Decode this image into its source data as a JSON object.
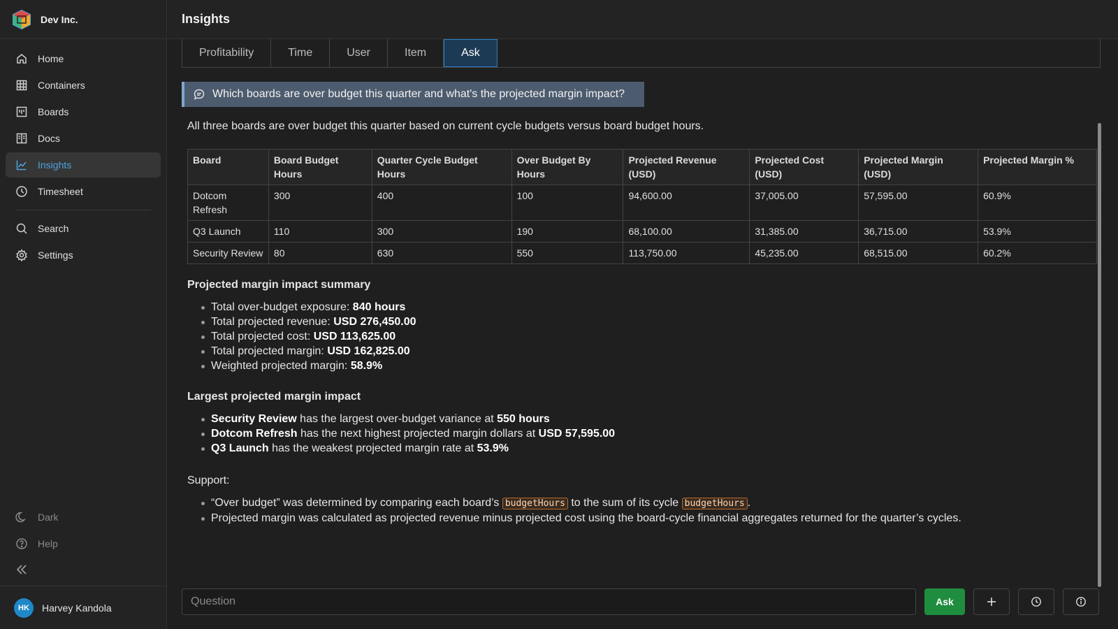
{
  "brand": {
    "name": "Dev Inc."
  },
  "nav": {
    "items": [
      {
        "label": "Home",
        "icon": "home-icon"
      },
      {
        "label": "Containers",
        "icon": "grid-icon"
      },
      {
        "label": "Boards",
        "icon": "board-icon"
      },
      {
        "label": "Docs",
        "icon": "book-icon"
      },
      {
        "label": "Insights",
        "icon": "chart-icon",
        "active": true
      },
      {
        "label": "Timesheet",
        "icon": "clock-icon"
      }
    ],
    "secondary": [
      {
        "label": "Search",
        "icon": "search-icon"
      },
      {
        "label": "Settings",
        "icon": "gear-icon"
      }
    ],
    "bottom": [
      {
        "label": "Dark",
        "icon": "moon-icon"
      },
      {
        "label": "Help",
        "icon": "help-icon"
      }
    ]
  },
  "user": {
    "initials": "HK",
    "name": "Harvey Kandola"
  },
  "header": {
    "title": "Insights"
  },
  "tabs": [
    {
      "label": "Profitability"
    },
    {
      "label": "Time"
    },
    {
      "label": "User"
    },
    {
      "label": "Item"
    },
    {
      "label": "Ask",
      "active": true
    }
  ],
  "question": "Which boards are over budget this quarter and what's the projected margin impact?",
  "answer": {
    "intro": "All three boards are over budget this quarter based on current cycle budgets versus board budget hours.",
    "table": {
      "headers": [
        "Board",
        "Board Budget Hours",
        "Quarter Cycle Budget Hours",
        "Over Budget By Hours",
        "Projected Revenue (USD)",
        "Projected Cost (USD)",
        "Projected Margin (USD)",
        "Projected Margin %"
      ],
      "rows": [
        [
          "Dotcom Refresh",
          "300",
          "400",
          "100",
          "94,600.00",
          "37,005.00",
          "57,595.00",
          "60.9%"
        ],
        [
          "Q3 Launch",
          "110",
          "300",
          "190",
          "68,100.00",
          "31,385.00",
          "36,715.00",
          "53.9%"
        ],
        [
          "Security Review",
          "80",
          "630",
          "550",
          "113,750.00",
          "45,235.00",
          "68,515.00",
          "60.2%"
        ]
      ]
    },
    "summary": {
      "title": "Projected margin impact summary",
      "items": [
        {
          "label": "Total over-budget exposure: ",
          "value": "840 hours"
        },
        {
          "label": "Total projected revenue: ",
          "value": "USD 276,450.00"
        },
        {
          "label": "Total projected cost: ",
          "value": "USD 113,625.00"
        },
        {
          "label": "Total projected margin: ",
          "value": "USD 162,825.00"
        },
        {
          "label": "Weighted projected margin: ",
          "value": "58.9%"
        }
      ]
    },
    "largest": {
      "title": "Largest projected margin impact",
      "items": [
        {
          "board": "Security Review",
          "text": " has the largest over-budget variance at ",
          "value": "550 hours"
        },
        {
          "board": "Dotcom Refresh",
          "text": " has the next highest projected margin dollars at ",
          "value": "USD 57,595.00"
        },
        {
          "board": "Q3 Launch",
          "text": " has the weakest projected margin rate at ",
          "value": "53.9%"
        }
      ]
    },
    "support": {
      "title": "Support:",
      "item1": {
        "pre": "“Over budget” was determined by comparing each board’s ",
        "code1": "budgetHours",
        "mid": " to the sum of its cycle ",
        "code2": "budgetHours",
        "post": "."
      },
      "item2": "Projected margin was calculated as projected revenue minus projected cost using the board-cycle financial aggregates returned for the quarter’s cycles."
    }
  },
  "ask_bar": {
    "placeholder": "Question",
    "ask_label": "Ask"
  }
}
